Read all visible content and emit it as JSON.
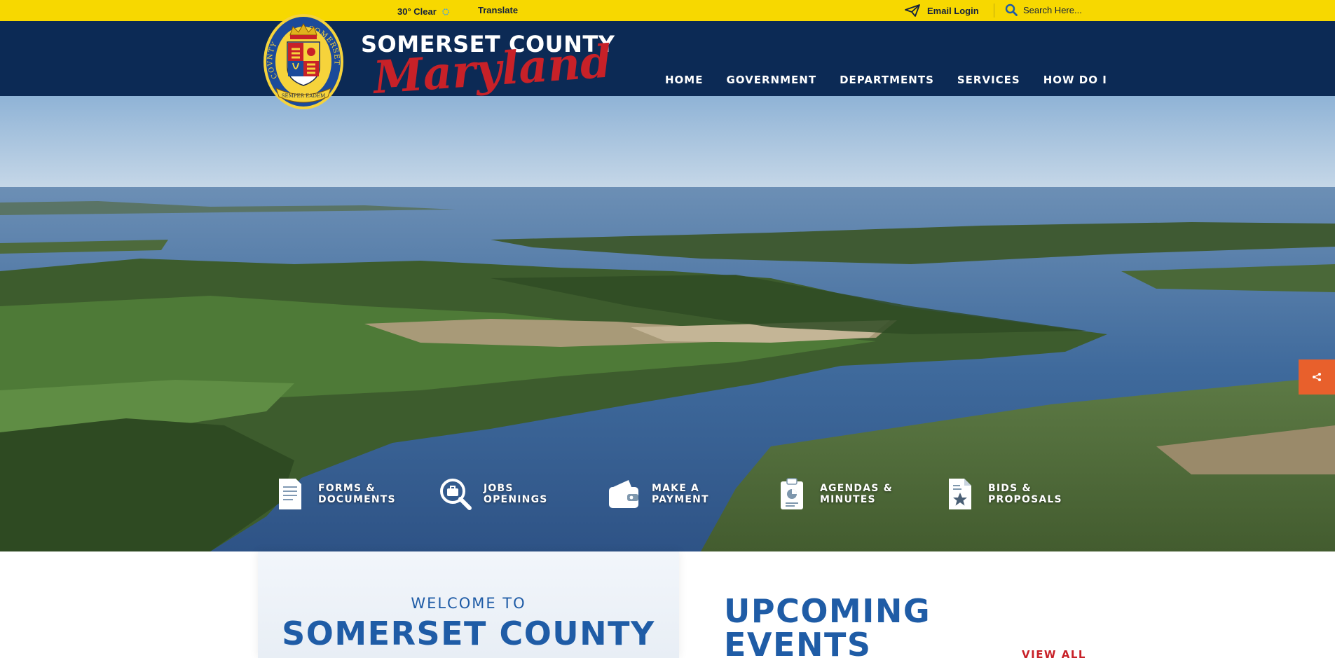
{
  "topbar": {
    "weather": "30° Clear",
    "weather_icon": "sun-icon",
    "translate": "Translate",
    "email_login": "Email Login",
    "email_icon": "paper-plane-icon",
    "search_placeholder": "Search Here...",
    "search_icon": "search-icon",
    "background_color": "#f7d800"
  },
  "header": {
    "county_name": "SOMERSET COUNTY",
    "state_name": "Maryland",
    "seal_text_left": "COVNTY",
    "seal_text_right": "SOMERSET",
    "seal_motto": "SEMPER EADEM",
    "background_color": "#0c2a55",
    "accent_color": "#c82128"
  },
  "nav": {
    "items": [
      {
        "label": "HOME"
      },
      {
        "label": "GOVERNMENT"
      },
      {
        "label": "DEPARTMENTS"
      },
      {
        "label": "SERVICES"
      },
      {
        "label": "HOW DO I"
      }
    ]
  },
  "hero": {
    "share_icon": "share-icon",
    "share_color": "#e8602c"
  },
  "quicklinks": [
    {
      "label": "FORMS &\nDOCUMENTS",
      "icon": "document-icon"
    },
    {
      "label": "JOBS\nOPENINGS",
      "icon": "job-search-icon"
    },
    {
      "label": "MAKE A\nPAYMENT",
      "icon": "wallet-icon"
    },
    {
      "label": "AGENDAS &\nMINUTES",
      "icon": "clipboard-chart-icon"
    },
    {
      "label": "BIDS &\nPROPOSALS",
      "icon": "document-star-icon"
    }
  ],
  "welcome": {
    "kicker": "WELCOME TO",
    "title": "SOMERSET COUNTY"
  },
  "events": {
    "title": "UPCOMING EVENTS",
    "view_all": "VIEW ALL"
  }
}
